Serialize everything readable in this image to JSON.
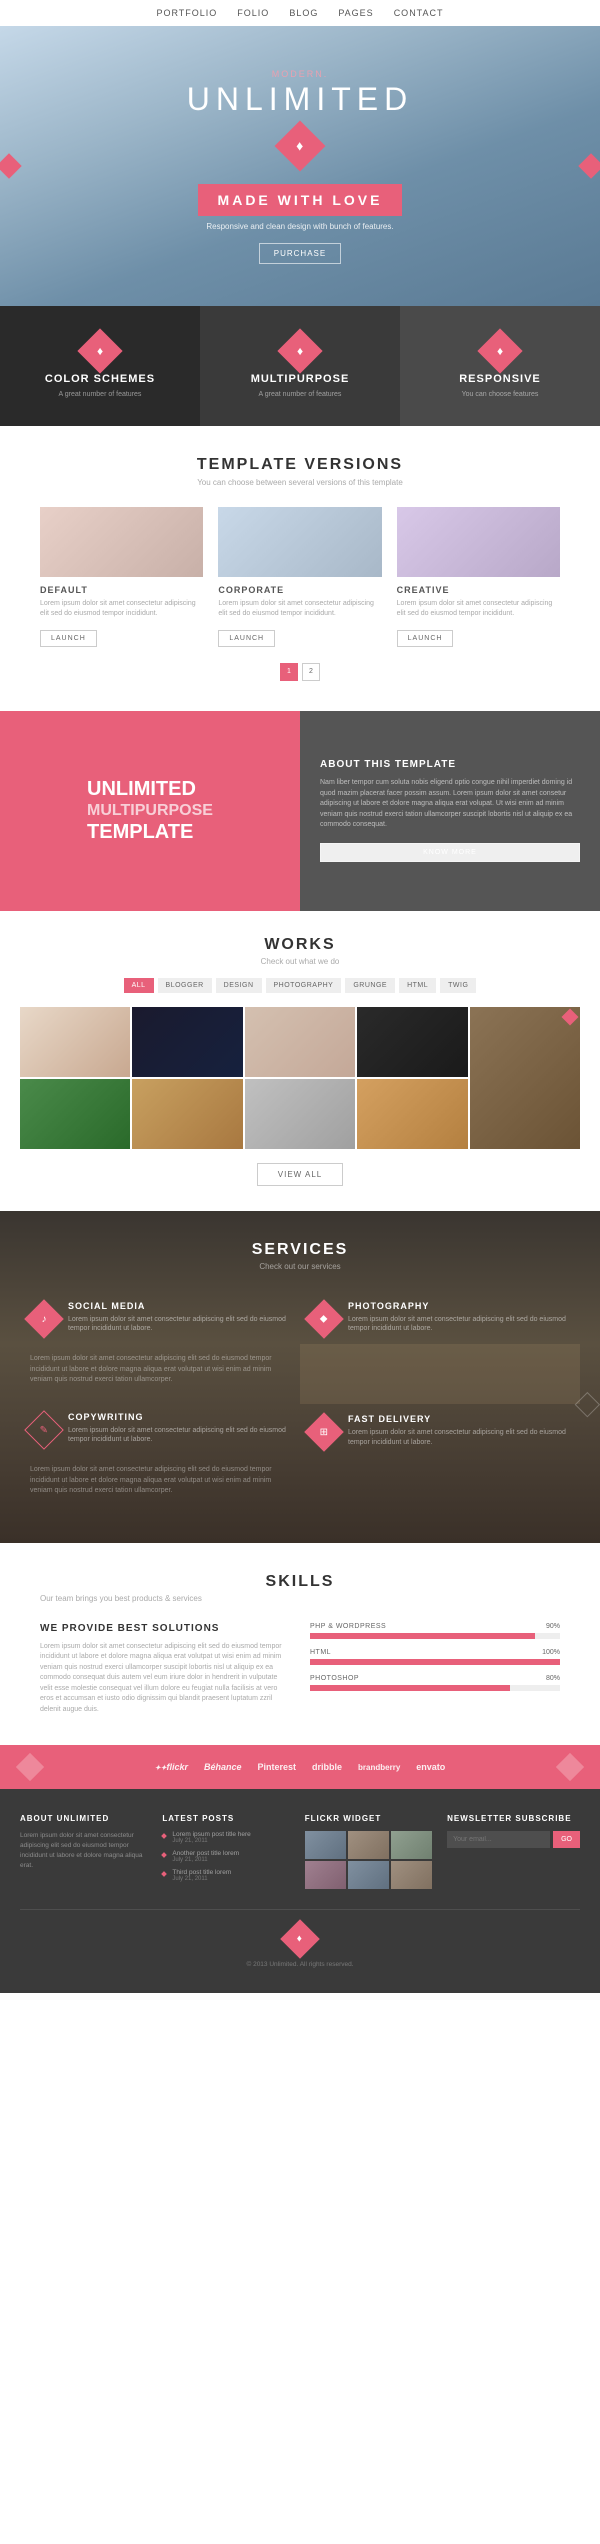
{
  "nav": {
    "items": [
      "PORTFOLIO",
      "FOLIO",
      "BLOG",
      "PAGES",
      "CONTACT"
    ]
  },
  "hero": {
    "brand": "modern.",
    "title": "UNLIMITED",
    "badge": "MADE WITH LOVE",
    "subtitle": "Responsive and clean design with bunch of features.",
    "button": "PURCHASE"
  },
  "features": [
    {
      "title": "COLOR SCHEMES",
      "sub": "A great number of features",
      "icon": "◆"
    },
    {
      "title": "MULTIPURPOSE",
      "sub": "A great number of features",
      "icon": "◆"
    },
    {
      "title": "RESPONSIVE",
      "sub": "You can choose features",
      "icon": "◆"
    }
  ],
  "versions": {
    "section_title": "TEMPLATE VERSIONS",
    "section_sub": "You can choose between several versions of this template",
    "items": [
      {
        "label": "DEFAULT",
        "desc": "Lorem ipsum dolor sit amet consectetur adipiscing elit sed do eiusmod tempor incididunt.",
        "btn": "LAUNCH"
      },
      {
        "label": "CORPORATE",
        "desc": "Lorem ipsum dolor sit amet consectetur adipiscing elit sed do eiusmod tempor incididunt.",
        "btn": "LAUNCH"
      },
      {
        "label": "CREATIVE",
        "desc": "Lorem ipsum dolor sit amet consectetur adipiscing elit sed do eiusmod tempor incididunt.",
        "btn": "LAUNCH"
      }
    ],
    "page1": "1",
    "page2": "2"
  },
  "about": {
    "left_line1": "UNLIMITED",
    "left_line2": "MULTIPURPOSE",
    "left_line3": "TEMPLATE",
    "right_title": "ABOUT THIS TEMPLATE",
    "right_text": "Nam liber tempor cum soluta nobis eligend optio congue nihil imperdiet doming id quod mazim placerat facer possim assum. Lorem ipsum dolor sit amet consetur adipiscing ut labore et dolore magna aliqua erat volupat. Ut wisi enim ad minim veniam quis nostrud exerci tation ullamcorper suscipit lobortis nisl ut aliquip ex ea commodo consequat.",
    "button": "KNOW MORE"
  },
  "works": {
    "title": "WORKS",
    "sub": "Check out what we do",
    "filters": [
      "ALL",
      "BLOGGER",
      "DESIGN",
      "PHOTOGRAPHY",
      "GRUNGE",
      "HTML",
      "TWIG"
    ],
    "active_filter": "ALL",
    "view_all": "VIEW ALL"
  },
  "services": {
    "title": "SERVICES",
    "sub": "Check out our services",
    "items": [
      {
        "name": "SOCIAL MEDIA",
        "icon": "♪",
        "desc": "Lorem ipsum dolor sit amet consectetur adipiscing elit sed do eiusmod tempor incididunt ut labore."
      },
      {
        "name": "PHOTOGRAPHY",
        "icon": "◆",
        "desc": "Lorem ipsum dolor sit amet consectetur adipiscing elit sed do eiusmod tempor incididunt ut labore."
      },
      {
        "name": "COPYWRITING",
        "icon": "✎",
        "desc": "Lorem ipsum dolor sit amet consectetur adipiscing elit sed do eiusmod tempor incididunt ut labore."
      },
      {
        "name": "FAST DELIVERY",
        "icon": "⊞",
        "desc": "Lorem ipsum dolor sit amet consectetur adipiscing elit sed do eiusmod tempor incididunt ut labore."
      }
    ],
    "left_text": "Lorem ipsum dolor sit amet consectetur adipiscing elit sed do eiusmod tempor incididunt ut labore et dolore magna aliqua erat volutpat ut wisi enim ad minim veniam quis nostrud exerci tation ullamcorper."
  },
  "skills": {
    "title": "SKILLS",
    "sub": "Our team brings you best products & services",
    "left_title": "WE PROVIDE BEST SOLUTIONS",
    "left_text": "Lorem ipsum dolor sit amet consectetur adipiscing elit sed do eiusmod tempor incididunt ut labore et dolore magna aliqua erat volutpat ut wisi enim ad minim veniam quis nostrud exerci ullamcorper suscipit lobortis nisl ut aliquip ex ea commodo consequat duis autem vel eum iriure dolor in hendrerit in vulputate velit esse molestie consequat vel illum dolore eu feugiat nulla facilisis at vero eros et accumsan et iusto odio dignissim qui blandit praesent luptatum zzril delenit augue duis.",
    "bars": [
      {
        "label": "PHP & WORDPRESS",
        "pct": 90,
        "pct_label": "90%"
      },
      {
        "label": "HTML",
        "pct": 100,
        "pct_label": "100%"
      },
      {
        "label": "PHOTOSHOP",
        "pct": 80,
        "pct_label": "80%"
      }
    ]
  },
  "partners": {
    "logos": [
      "**flickr",
      "Béhance",
      "Pinterest",
      "dribble",
      "brandberry",
      "envato"
    ]
  },
  "footer": {
    "cols": [
      {
        "title": "ABOUT UNLIMITED",
        "text": "Lorem ipsum dolor sit amet consectetur adipiscing elit sed do eiusmod tempor incididunt ut labore et dolore magna aliqua erat."
      },
      {
        "title": "LATEST POSTS",
        "posts": [
          {
            "text": "Lorem ipsum post title here",
            "date": "July 21, 2011"
          },
          {
            "text": "Another post title lorem",
            "date": "July 21, 2011"
          },
          {
            "text": "Third post title lorem",
            "date": "July 21, 2011"
          }
        ]
      },
      {
        "title": "FLICKR WIDGET"
      },
      {
        "title": "NEWSLETTER SUBSCRIBE",
        "placeholder": "Your email...",
        "btn": "GO"
      }
    ],
    "copyright": "© 2013 Unlimited. All rights reserved."
  }
}
